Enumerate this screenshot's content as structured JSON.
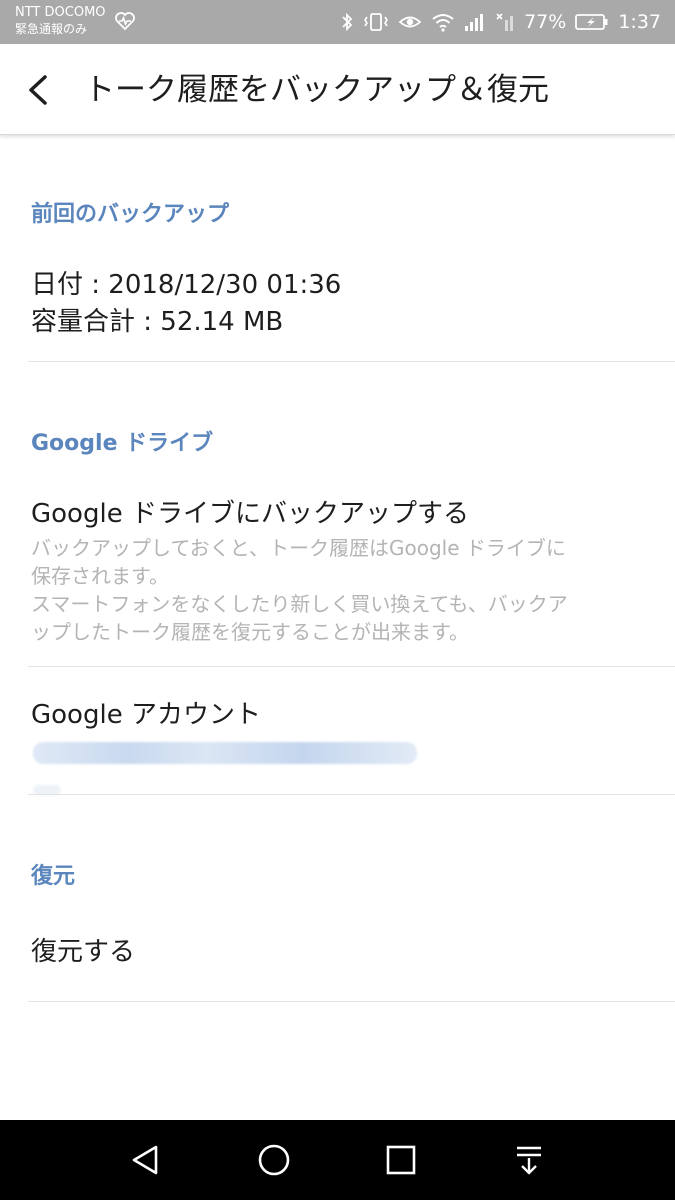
{
  "status_bar": {
    "carrier_line1": "NTT DOCOMO",
    "carrier_line2": "緊急通報のみ",
    "battery_percent": "77%",
    "time": "1:37",
    "icons": [
      "heart-monitor-icon",
      "bluetooth-icon",
      "vibrate-icon",
      "eye-comfort-icon",
      "wifi-icon",
      "signal-icon",
      "no-signal-icon",
      "battery-icon"
    ]
  },
  "app_bar": {
    "title": "トーク履歴をバックアップ＆復元",
    "back_icon": "back-arrow-icon"
  },
  "last_backup": {
    "header": "前回のバックアップ",
    "date_line": "日付 : 2018/12/30 01:36",
    "size_line": "容量合計 : 52.14 MB"
  },
  "google_drive": {
    "header": "Google ドライブ",
    "backup_title": "Google ドライブにバックアップする",
    "backup_desc_line1": "バックアップしておくと、トーク履歴はGoogle ドライブに",
    "backup_desc_line2": "保存されます。",
    "backup_desc_line3": "スマートフォンをなくしたり新しく買い換えても、バックア",
    "backup_desc_line4": "ップしたトーク履歴を復元することが出来ます。",
    "account_title": "Google アカウント"
  },
  "restore": {
    "header": "復元",
    "restore_label": "復元する"
  },
  "nav_bar": {
    "icons": [
      "nav-back-icon",
      "nav-home-icon",
      "nav-recents-icon",
      "nav-notification-pull-icon"
    ]
  },
  "colors": {
    "status_bar_bg": "#a9a9a9",
    "section_header": "#5b86bd",
    "primary_text": "#1e1e1e",
    "secondary_text": "#b4b4b4",
    "nav_bar_bg": "#000000"
  }
}
